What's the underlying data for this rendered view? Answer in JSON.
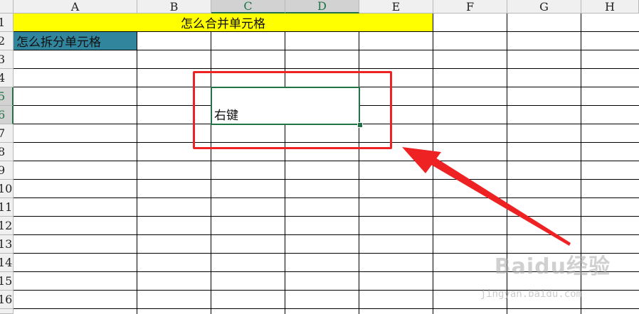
{
  "column_headers": [
    "A",
    "B",
    "C",
    "D",
    "E",
    "F",
    "G",
    "H"
  ],
  "row_headers": [
    "1",
    "2",
    "3",
    "4",
    "5",
    "6",
    "7",
    "8",
    "9",
    "10",
    "11",
    "12",
    "13",
    "14",
    "15",
    "16"
  ],
  "selected_columns": [
    "C",
    "D"
  ],
  "selected_rows": [
    "5",
    "6"
  ],
  "cells": {
    "merged_title": "怎么合并单元格",
    "split_label": "怎么拆分单元格",
    "selected_merged": "右键"
  },
  "colors": {
    "merged_title_fill": "#ffff00",
    "split_label_fill": "#31859c",
    "selection_border": "#217346",
    "annotation_red": "#ee2222"
  },
  "annotation": {
    "arrow_icon": "red-arrow-icon",
    "box_icon": "red-highlight-box"
  },
  "watermark": {
    "brand": "Baidu经验",
    "url": "jingyan.baidu.com"
  }
}
